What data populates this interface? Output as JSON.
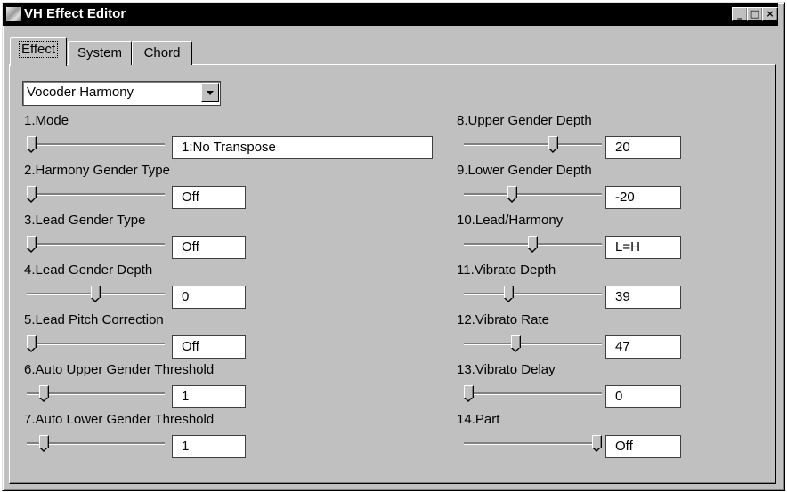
{
  "window": {
    "title": "VH Effect Editor",
    "controls": {
      "minimize": "_",
      "maximize": "□",
      "close": "×"
    }
  },
  "tabs": [
    {
      "label": "Effect",
      "active": true
    },
    {
      "label": "System",
      "active": false
    },
    {
      "label": "Chord",
      "active": false
    }
  ],
  "effect_type": {
    "selected": "Vocoder Harmony"
  },
  "params_left": [
    {
      "label": "1.Mode",
      "value": "1:No Transpose",
      "level": 0
    },
    {
      "label": "2.Harmony Gender Type",
      "value": "Off",
      "level": 0
    },
    {
      "label": "3.Lead Gender Type",
      "value": "Off",
      "level": 0
    },
    {
      "label": "4.Lead Gender Depth",
      "value": "0",
      "level": 0.5
    },
    {
      "label": "5.Lead Pitch Correction",
      "value": "Off",
      "level": 0
    },
    {
      "label": "6.Auto Upper Gender Threshold",
      "value": "1",
      "level": 0.1
    },
    {
      "label": "7.Auto Lower Gender Threshold",
      "value": "1",
      "level": 0.1
    }
  ],
  "params_right": [
    {
      "label": "8.Upper Gender Depth",
      "value": "20",
      "level": 0.66
    },
    {
      "label": "9.Lower Gender Depth",
      "value": "-20",
      "level": 0.34
    },
    {
      "label": "10.Lead/Harmony",
      "value": "L=H",
      "level": 0.5
    },
    {
      "label": "11.Vibrato Depth",
      "value": "39",
      "level": 0.31
    },
    {
      "label": "12.Vibrato Rate",
      "value": "47",
      "level": 0.37
    },
    {
      "label": "13.Vibrato Delay",
      "value": "0",
      "level": 0
    },
    {
      "label": "14.Part",
      "value": "Off",
      "level": 1
    }
  ]
}
